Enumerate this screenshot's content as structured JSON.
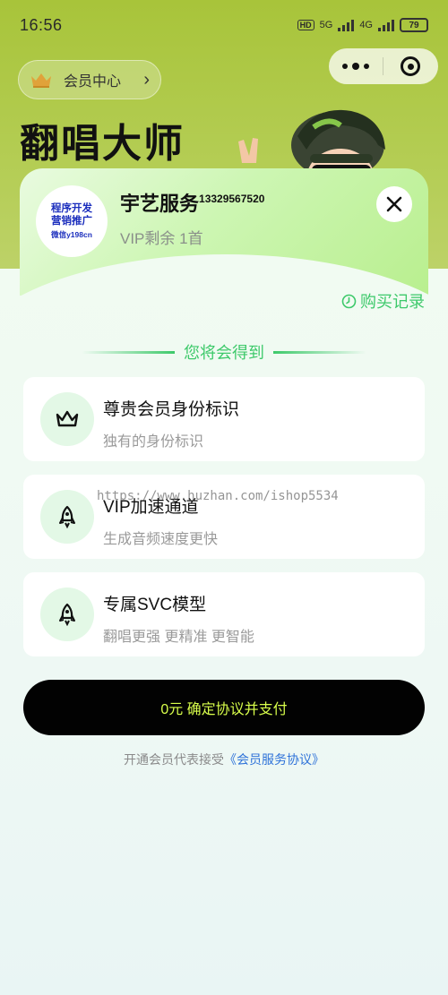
{
  "status_bar": {
    "time": "16:56",
    "hd_label": "HD",
    "net1": "5G",
    "net2": "4G",
    "battery": "79"
  },
  "header": {
    "member_center_label": "会员中心",
    "app_title": "翻唱大师"
  },
  "promo_badge": {
    "line1": "程序开发",
    "line2": "营销推广",
    "line3": "微信y198cn"
  },
  "user": {
    "name": "宇艺服务",
    "name_suffix": "13329567520",
    "vip_remaining": "VIP剩余 1首"
  },
  "purchase_record_label": "购买记录",
  "benefits_heading": "您将会得到",
  "benefits": [
    {
      "title": "尊贵会员身份标识",
      "subtitle": "独有的身份标识",
      "icon": "crown-icon"
    },
    {
      "title": "VIP加速通道",
      "subtitle": "生成音频速度更快",
      "icon": "rocket-icon"
    },
    {
      "title": "专属SVC模型",
      "subtitle": "翻唱更强 更精准 更智能",
      "icon": "rocket-icon"
    }
  ],
  "watermark": "https://www.huzhan.com/ishop5534",
  "pay_button_label": "0元 确定协议并支付",
  "agreement": {
    "prefix": "开通会员代表接受",
    "link": "《会员服务协议》"
  },
  "colors": {
    "accent_green": "#3dc96a",
    "hero_green": "#a8c43a",
    "pay_text": "#d9ff4b",
    "link_blue": "#2f73d9"
  }
}
